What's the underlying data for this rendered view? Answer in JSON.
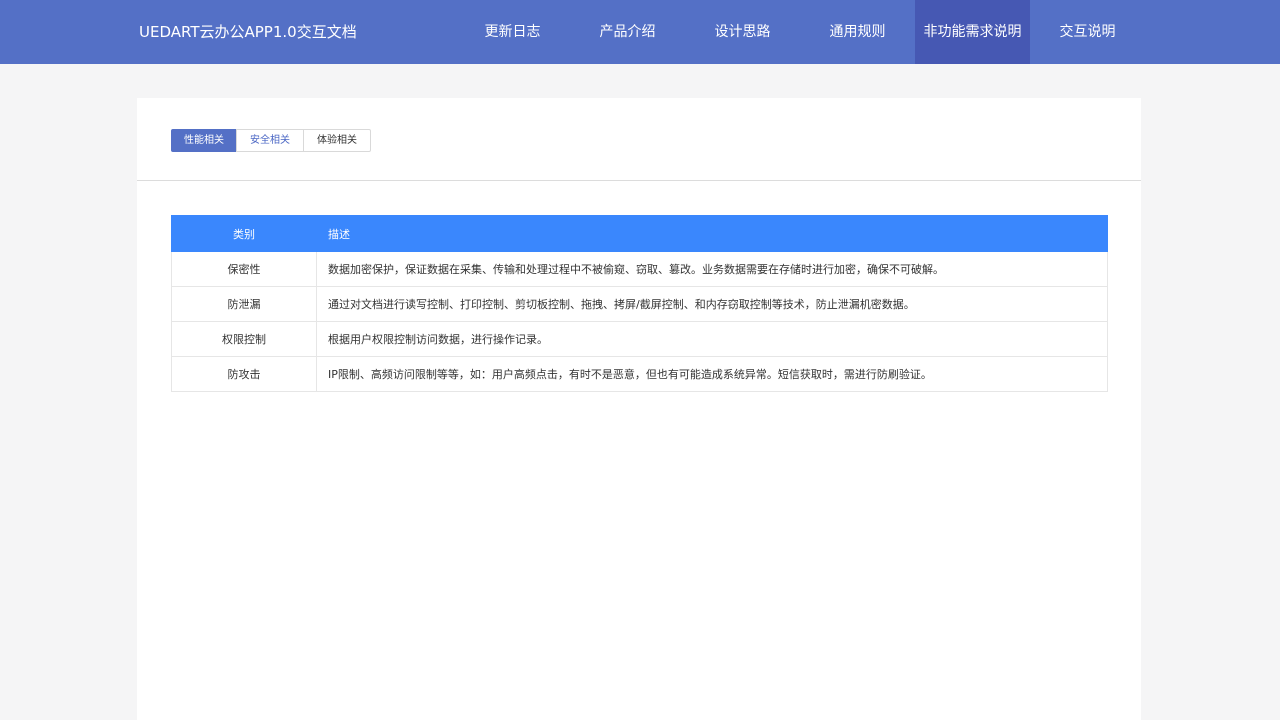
{
  "header": {
    "title": "UEDART云办公APP1.0交互文档",
    "nav": [
      {
        "label": "更新日志"
      },
      {
        "label": "产品介绍"
      },
      {
        "label": "设计思路"
      },
      {
        "label": "通用规则"
      },
      {
        "label": "非功能需求说明"
      },
      {
        "label": "交互说明"
      }
    ],
    "active_nav": "非功能需求说明"
  },
  "tabs": [
    {
      "label": "性能相关"
    },
    {
      "label": "安全相关"
    },
    {
      "label": "体验相关"
    }
  ],
  "active_tab": "性能相关",
  "table": {
    "columns": [
      "类别",
      "描述"
    ],
    "rows": [
      {
        "category": "保密性",
        "description": "数据加密保护，保证数据在采集、传输和处理过程中不被偷窥、窃取、篡改。业务数据需要在存储时进行加密，确保不可破解。"
      },
      {
        "category": "防泄漏",
        "description": "通过对文档进行读写控制、打印控制、剪切板控制、拖拽、拷屏/截屏控制、和内存窃取控制等技术，防止泄漏机密数据。"
      },
      {
        "category": "权限控制",
        "description": "根据用户权限控制访问数据，进行操作记录。"
      },
      {
        "category": "防攻击",
        "description": "IP限制、高频访问限制等等，如：用户高频点击，有时不是恶意，但也有可能造成系统异常。短信获取时，需进行防刷验证。"
      }
    ]
  },
  "colors": {
    "header_bg": "#5470c6",
    "nav_active_bg": "#4658b3",
    "table_header_bg": "#3a87fd",
    "tab_active_bg": "#5470c6"
  }
}
